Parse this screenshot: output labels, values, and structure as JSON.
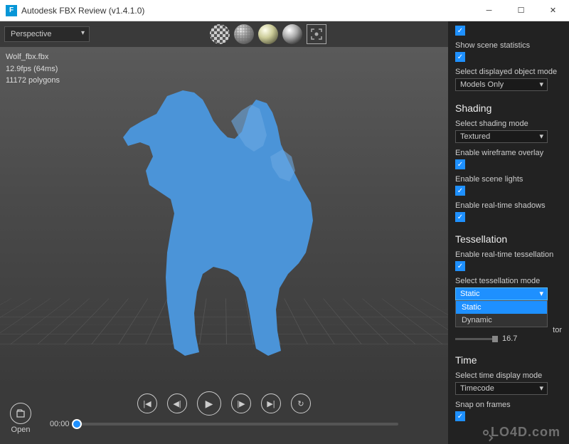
{
  "window": {
    "title": "Autodesk FBX Review (v1.4.1.0)"
  },
  "viewport": {
    "camera_dropdown": "Perspective",
    "stats": {
      "filename": "Wolf_fbx.fbx",
      "fps": "12.9fps (64ms)",
      "polys": "11172 polygons"
    }
  },
  "playback": {
    "open_label": "Open",
    "timecode": "00:00"
  },
  "sidebar": {
    "top": {
      "show_stats_label": "Show scene statistics",
      "object_mode_label": "Select displayed object mode",
      "object_mode_value": "Models Only"
    },
    "shading": {
      "heading": "Shading",
      "mode_label": "Select shading mode",
      "mode_value": "Textured",
      "wire_label": "Enable wireframe overlay",
      "lights_label": "Enable scene lights",
      "shadows_label": "Enable real-time shadows"
    },
    "tess": {
      "heading": "Tessellation",
      "enable_label": "Enable real-time tessellation",
      "mode_label": "Select tessellation mode",
      "mode_value": "Static",
      "options": [
        "Static",
        "Dynamic"
      ],
      "factor_suffix": "tor",
      "factor_value": "16.7"
    },
    "time": {
      "heading": "Time",
      "mode_label": "Select time display mode",
      "mode_value": "Timecode",
      "snap_label": "Snap on frames"
    }
  },
  "watermark": "LO4D.com"
}
